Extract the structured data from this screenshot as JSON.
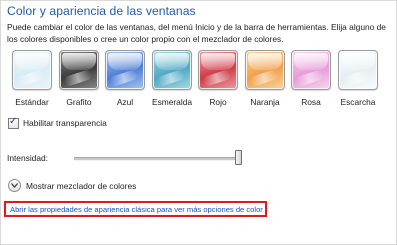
{
  "header": {
    "title": "Color y apariencia de las ventanas",
    "description": "Puede cambiar el color de las ventanas, del menú Inicio y de la barra de herramientas. Elija alguno de los colores disponibles o cree un color propio con el mezclador de colores."
  },
  "swatches": [
    {
      "label": "Estándar",
      "icon": "color-swatch-estandar",
      "base": "#d8ecf6",
      "tint": "#e9f4fa"
    },
    {
      "label": "Grafito",
      "icon": "color-swatch-grafito",
      "base": "#3c3c3c",
      "tint": "#8a8a8a"
    },
    {
      "label": "Azul",
      "icon": "color-swatch-azul",
      "base": "#4d80d6",
      "tint": "#a9c4f0"
    },
    {
      "label": "Esmeralda",
      "icon": "color-swatch-esmeralda",
      "base": "#4fa7c4",
      "tint": "#a5dbe3"
    },
    {
      "label": "Rojo",
      "icon": "color-swatch-rojo",
      "base": "#cd3d48",
      "tint": "#ee9ca1"
    },
    {
      "label": "Naranja",
      "icon": "color-swatch-naranja",
      "base": "#f0a04b",
      "tint": "#f8d59a"
    },
    {
      "label": "Rosa",
      "icon": "color-swatch-rosa",
      "base": "#e89bd9",
      "tint": "#f7d6f0"
    },
    {
      "label": "Escarcha",
      "icon": "color-swatch-escarcha",
      "base": "#e6eef2",
      "tint": "#f8fbfc"
    }
  ],
  "transparency": {
    "label": "Habilitar transparencia",
    "checked": true
  },
  "intensity": {
    "label": "Intensidad:",
    "value_percent": 100
  },
  "mixer": {
    "label": "Mostrar mezclador de colores",
    "icon": "chevron-down-icon"
  },
  "classic_link": {
    "text": "Abrir las propiedades de apariencia clásica para ver más opciones de color"
  },
  "colors": {
    "title": "#1f5ca8",
    "link": "#1455c0",
    "highlight_border": "#e0191b"
  }
}
